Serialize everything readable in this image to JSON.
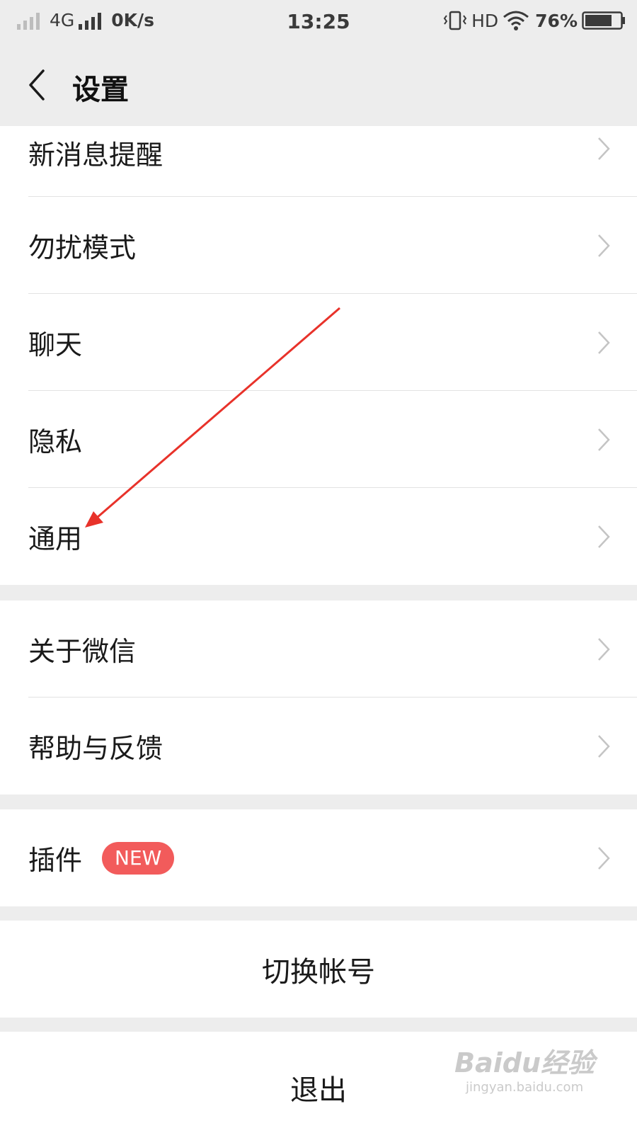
{
  "status_bar": {
    "network": "4G",
    "speed": "0K/s",
    "time": "13:25",
    "hd": "HD",
    "battery": "76%"
  },
  "nav": {
    "title": "设置"
  },
  "group1": [
    {
      "label": "新消息提醒"
    },
    {
      "label": "勿扰模式"
    },
    {
      "label": "聊天"
    },
    {
      "label": "隐私"
    },
    {
      "label": "通用"
    }
  ],
  "group2": [
    {
      "label": "关于微信"
    },
    {
      "label": "帮助与反馈"
    }
  ],
  "group3": [
    {
      "label": "插件",
      "badge": "NEW"
    }
  ],
  "switch_account": "切换帐号",
  "logout": "退出",
  "watermark": {
    "brand": "Baidu经验",
    "url": "jingyan.baidu.com"
  },
  "colors": {
    "badge": "#f25b5b",
    "annotation_arrow": "#e8322a"
  }
}
